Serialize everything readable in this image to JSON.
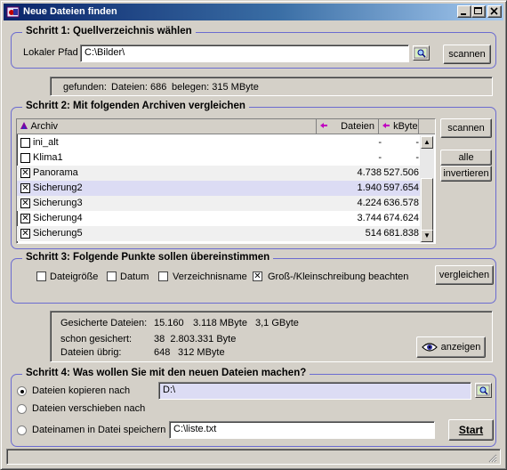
{
  "window": {
    "title": "Neue Dateien finden"
  },
  "step1": {
    "title": "Schritt 1: Quellverzeichnis wählen",
    "path_label": "Lokaler Pfad",
    "path_value": "C:\\Bilder\\",
    "scan_button": "scannen",
    "found_label": "gefunden:",
    "found_files": "Dateien: 686",
    "found_size": "belegen: 315 MByte"
  },
  "step2": {
    "title": "Schritt 2: Mit folgenden Archiven vergleichen",
    "columns": {
      "archive": "Archiv",
      "files": "Dateien",
      "kbyte": "kByte"
    },
    "rows": [
      {
        "name": "ini_alt",
        "files": "-",
        "kbyte": "-",
        "checked": false
      },
      {
        "name": "Klima1",
        "files": "-",
        "kbyte": "-",
        "checked": false
      },
      {
        "name": "Panorama",
        "files": "4.738",
        "kbyte": "527.506",
        "checked": true
      },
      {
        "name": "Sicherung2",
        "files": "1.940",
        "kbyte": "597.654",
        "checked": true
      },
      {
        "name": "Sicherung3",
        "files": "4.224",
        "kbyte": "636.578",
        "checked": true
      },
      {
        "name": "Sicherung4",
        "files": "3.744",
        "kbyte": "674.624",
        "checked": true
      },
      {
        "name": "Sicherung5",
        "files": "514",
        "kbyte": "681.838",
        "checked": true
      }
    ],
    "scan_button": "scannen",
    "all_button": "alle",
    "invert_button": "invertieren"
  },
  "step3": {
    "title": "Schritt 3: Folgende Punkte sollen übereinstimmen",
    "options": [
      {
        "label": "Dateigröße",
        "checked": false
      },
      {
        "label": "Datum",
        "checked": false
      },
      {
        "label": "Verzeichnisname",
        "checked": false
      },
      {
        "label": "Groß-/Kleinschreibung beachten",
        "checked": true
      }
    ],
    "compare_button": "vergleichen"
  },
  "summary": {
    "saved_label": "Gesicherte Dateien:",
    "saved_count": "15.160",
    "saved_mb": "3.118 MByte",
    "saved_gb": "3,1 GByte",
    "already_label": "schon gesichert:",
    "already_value": "38  2.803.331 Byte",
    "remaining_label": "Dateien übrig:",
    "remaining_count": "648",
    "remaining_mb": "312 MByte",
    "show_button": "anzeigen"
  },
  "step4": {
    "title": "Schritt 4: Was wollen Sie mit den neuen Dateien machen?",
    "copy_label": "Dateien kopieren nach",
    "copy_value": "D:\\",
    "move_label": "Dateien verschieben nach",
    "save_label": "Dateinamen in Datei speichern",
    "save_value": "C:\\liste.txt",
    "selected": "copy",
    "start_button": "Start"
  },
  "colors": {
    "titlebar_start": "#0a246a",
    "titlebar_end": "#a6caf0",
    "group_border": "#6b6bd0",
    "selection": "#dcdcf4"
  }
}
